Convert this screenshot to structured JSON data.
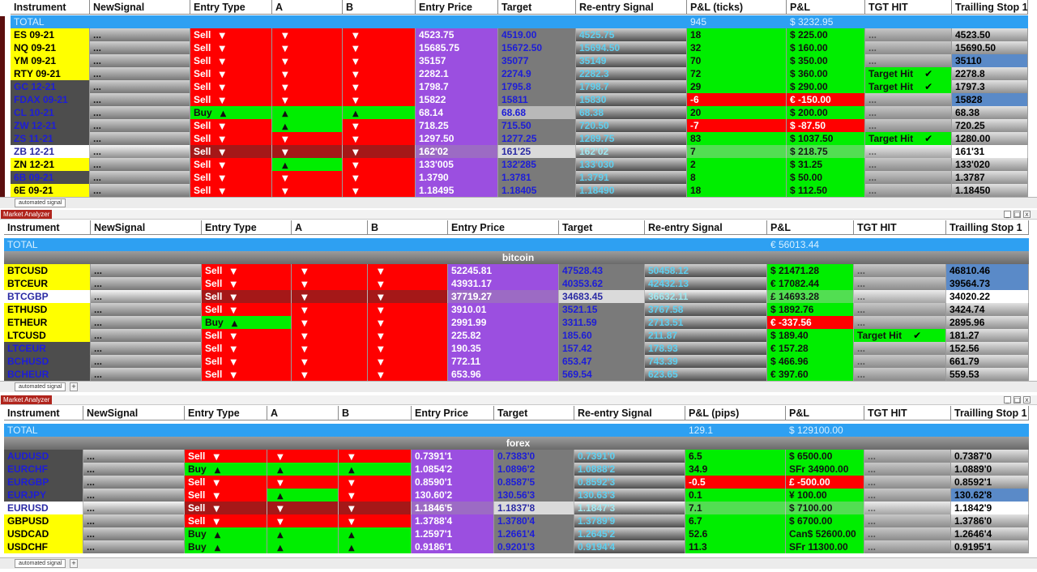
{
  "windows": [
    {
      "window_label": "",
      "tab_label": "automated signal",
      "columns": [
        "Instrument",
        "NewSignal",
        "Entry Type",
        "A",
        "B",
        "Entry Price",
        "Target",
        "Re-entry Signal",
        "P&L (ticks)",
        "P&L",
        "TGT HIT",
        "Trailling Stop 1"
      ],
      "total": {
        "label": "TOTAL",
        "ticks": "945",
        "pnl": "$ 3232.95"
      },
      "group": "",
      "rows": [
        {
          "inst": "ES 09-21",
          "sig": "...",
          "type": "Sell",
          "a": "▼",
          "b": "▼",
          "entry": "4523.75",
          "target": "4519.00",
          "reentry": "4525.75",
          "ticks": "18",
          "pnl": "$ 225.00",
          "tgt": "...",
          "trail": "4523.50",
          "ic": "yellow",
          "tc": "sell",
          "ac": "sell",
          "bc": "sell",
          "pc": "green",
          "hc": "empty",
          "sc": "trail",
          "tgc": "tgt"
        },
        {
          "inst": "NQ 09-21",
          "sig": "...",
          "type": "Sell",
          "a": "▼",
          "b": "▼",
          "entry": "15685.75",
          "target": "15672.50",
          "reentry": "15694.50",
          "ticks": "32",
          "pnl": "$ 160.00",
          "tgt": "...",
          "trail": "15690.50",
          "ic": "yellow",
          "tc": "sell",
          "ac": "sell",
          "bc": "sell",
          "pc": "green",
          "hc": "empty",
          "sc": "trail",
          "tgc": "tgt"
        },
        {
          "inst": "YM 09-21",
          "sig": "...",
          "type": "Sell",
          "a": "▼",
          "b": "▼",
          "entry": "35157",
          "target": "35077",
          "reentry": "35149",
          "ticks": "70",
          "pnl": "$ 350.00",
          "tgt": "...",
          "trail": "35110",
          "ic": "yellow",
          "tc": "sell",
          "ac": "sell",
          "bc": "sell",
          "pc": "green",
          "hc": "empty",
          "sc": "trailb",
          "tgc": "tgt"
        },
        {
          "inst": "RTY 09-21",
          "sig": "...",
          "type": "Sell",
          "a": "▼",
          "b": "▼",
          "entry": "2282.1",
          "target": "2274.9",
          "reentry": "2282.3",
          "ticks": "72",
          "pnl": "$ 360.00",
          "tgt": "Target Hit",
          "trail": "2278.8",
          "ic": "yellow",
          "tc": "sell",
          "ac": "sell",
          "bc": "sell",
          "pc": "green",
          "hc": "hit",
          "sc": "trail",
          "tgc": "tgt"
        },
        {
          "inst": "GC 12-21",
          "sig": "...",
          "type": "Sell",
          "a": "▼",
          "b": "▼",
          "entry": "1798.7",
          "target": "1795.8",
          "reentry": "1798.7",
          "ticks": "29",
          "pnl": "$ 290.00",
          "tgt": "Target Hit",
          "trail": "1797.3",
          "ic": "slate",
          "tc": "sell",
          "ac": "sell",
          "bc": "sell",
          "pc": "green",
          "hc": "hit",
          "sc": "trail",
          "tgc": "tgt"
        },
        {
          "inst": "FDAX 09-21",
          "sig": "...",
          "type": "Sell",
          "a": "▼",
          "b": "▼",
          "entry": "15822",
          "target": "15811",
          "reentry": "15830",
          "ticks": "-6",
          "pnl": "€ -150.00",
          "tgt": "...",
          "trail": "15828",
          "ic": "slate",
          "tc": "sell",
          "ac": "sell",
          "bc": "sell",
          "pc": "red",
          "hc": "empty",
          "sc": "trailb",
          "tgc": "tgt"
        },
        {
          "inst": "CL 10-21",
          "sig": "...",
          "type": "Buy",
          "a": "▲",
          "b": "▲",
          "entry": "68.14",
          "target": "68.68",
          "reentry": "68.38",
          "ticks": "20",
          "pnl": "$ 200.00",
          "tgt": "...",
          "trail": "68.38",
          "ic": "slate",
          "tc": "buy",
          "ac": "buy",
          "bc": "buy",
          "pc": "green",
          "hc": "empty",
          "sc": "trail",
          "tgc": "tgtl"
        },
        {
          "inst": "ZW 12-21",
          "sig": "...",
          "type": "Sell",
          "a": "▲",
          "b": "▼",
          "entry": "718.25",
          "target": "715.50",
          "reentry": "720.50",
          "ticks": "-7",
          "pnl": "$ -87.50",
          "tgt": "...",
          "trail": "720.25",
          "ic": "slate",
          "tc": "sell",
          "ac": "buy",
          "bc": "sell",
          "pc": "red",
          "hc": "empty",
          "sc": "trail",
          "tgc": "tgt"
        },
        {
          "inst": "ZS 11-21",
          "sig": "...",
          "type": "Sell",
          "a": "▼",
          "b": "▼",
          "entry": "1297.50",
          "target": "1277.25",
          "reentry": "1289.75",
          "ticks": "83",
          "pnl": "$ 1037.50",
          "tgt": "Target Hit",
          "trail": "1280.00",
          "ic": "slate",
          "tc": "sell",
          "ac": "sell",
          "bc": "sell",
          "pc": "green",
          "hc": "hit",
          "sc": "trail",
          "tgc": "tgt"
        },
        {
          "inst": "ZB 12-21",
          "sig": "...",
          "type": "Sell",
          "a": "▼",
          "b": "▼",
          "entry": "162'02",
          "target": "161'25",
          "reentry": "162'02",
          "ticks": "7",
          "pnl": "$ 218.75",
          "tgt": "...",
          "trail": "161'31",
          "ic": "white",
          "tc": "sell",
          "ac": "sell",
          "bc": "sell",
          "pc": "green",
          "hc": "empty",
          "sc": "trailw",
          "tgc": "tgtl",
          "hl": true
        },
        {
          "inst": "ZN 12-21",
          "sig": "...",
          "type": "Sell",
          "a": "▲",
          "b": "▼",
          "entry": "133'005",
          "target": "132'285",
          "reentry": "133'030",
          "ticks": "2",
          "pnl": "$ 31.25",
          "tgt": "...",
          "trail": "133'020",
          "ic": "ykeep",
          "tc": "sell",
          "ac": "buy",
          "bc": "sell",
          "pc": "green",
          "hc": "empty",
          "sc": "trail",
          "tgc": "tgt"
        },
        {
          "inst": "6B 09-21",
          "sig": "...",
          "type": "Sell",
          "a": "▼",
          "b": "▼",
          "entry": "1.3790",
          "target": "1.3781",
          "reentry": "1.3791",
          "ticks": "8",
          "pnl": "$ 50.00",
          "tgt": "...",
          "trail": "1.3787",
          "ic": "slate",
          "tc": "sell",
          "ac": "sell",
          "bc": "sell",
          "pc": "green",
          "hc": "empty",
          "sc": "trail",
          "tgc": "tgt"
        },
        {
          "inst": "6E 09-21",
          "sig": "...",
          "type": "Sell",
          "a": "▼",
          "b": "▼",
          "entry": "1.18495",
          "target": "1.18405",
          "reentry": "1.18490",
          "ticks": "18",
          "pnl": "$ 112.50",
          "tgt": "...",
          "trail": "1.18450",
          "ic": "yellow",
          "tc": "sell",
          "ac": "sell",
          "bc": "sell",
          "pc": "green",
          "hc": "empty",
          "sc": "trail",
          "tgc": "tgt"
        }
      ]
    },
    {
      "window_label": "Market Analyzer",
      "tab_label": "automated signal",
      "columns": [
        "Instrument",
        "NewSignal",
        "Entry Type",
        "A",
        "B",
        "Entry Price",
        "Target",
        "Re-entry Signal",
        "P&L",
        "TGT HIT",
        "Trailling Stop 1"
      ],
      "total": {
        "label": "TOTAL",
        "ticks": "",
        "pnl": "€ 56013.44"
      },
      "group": "bitcoin",
      "rows": [
        {
          "inst": "BTCUSD",
          "sig": "...",
          "type": "Sell",
          "a": "▼",
          "b": "▼",
          "entry": "52245.81",
          "target": "47528.43",
          "reentry": "50458.12",
          "pnl": "$ 21471.28",
          "tgt": "...",
          "trail": "46810.46",
          "ic": "yellow",
          "tc": "sell",
          "ac": "sell",
          "bc": "sell",
          "pc": "green",
          "hc": "empty",
          "sc": "trailb",
          "tgc": "tgt"
        },
        {
          "inst": "BTCEUR",
          "sig": "...",
          "type": "Sell",
          "a": "▼",
          "b": "▼",
          "entry": "43931.17",
          "target": "40353.62",
          "reentry": "42432.13",
          "pnl": "€ 17082.44",
          "tgt": "...",
          "trail": "39564.73",
          "ic": "yellow",
          "tc": "sell",
          "ac": "sell",
          "bc": "sell",
          "pc": "green",
          "hc": "empty",
          "sc": "trailb",
          "tgc": "tgt"
        },
        {
          "inst": "BTCGBP",
          "sig": "...",
          "type": "Sell",
          "a": "▼",
          "b": "▼",
          "entry": "37719.27",
          "target": "34683.45",
          "reentry": "36632.11",
          "pnl": "£ 14693.28",
          "tgt": "...",
          "trail": "34020.22",
          "ic": "white",
          "tc": "sell",
          "ac": "sell",
          "bc": "sell",
          "pc": "green",
          "hc": "empty",
          "sc": "trailw",
          "tgc": "tgtl",
          "hl": true
        },
        {
          "inst": "ETHUSD",
          "sig": "...",
          "type": "Sell",
          "a": "▼",
          "b": "▼",
          "entry": "3910.01",
          "target": "3521.15",
          "reentry": "3767.58",
          "pnl": "$ 1892.76",
          "tgt": "...",
          "trail": "3424.74",
          "ic": "yellow",
          "tc": "sell",
          "ac": "sell",
          "bc": "sell",
          "pc": "green",
          "hc": "empty",
          "sc": "trail",
          "tgc": "tgt"
        },
        {
          "inst": "ETHEUR",
          "sig": "...",
          "type": "Buy",
          "a": "▼",
          "b": "▼",
          "entry": "2991.99",
          "target": "3311.59",
          "reentry": "2713.51",
          "pnl": "€ -337.56",
          "tgt": "...",
          "trail": "2895.96",
          "ic": "yellow",
          "tc": "buy",
          "ac": "sell",
          "bc": "sell",
          "pc": "red",
          "hc": "empty",
          "sc": "trail",
          "tgc": "tgt"
        },
        {
          "inst": "LTCUSD",
          "sig": "...",
          "type": "Sell",
          "a": "▼",
          "b": "▼",
          "entry": "225.82",
          "target": "185.60",
          "reentry": "211.87",
          "pnl": "$ 189.40",
          "tgt": "Target Hit",
          "trail": "181.27",
          "ic": "yellow",
          "tc": "sell",
          "ac": "sell",
          "bc": "sell",
          "pc": "green",
          "hc": "hit",
          "sc": "trail",
          "tgc": "tgt"
        },
        {
          "inst": "LTCEUR",
          "sig": "...",
          "type": "Sell",
          "a": "▼",
          "b": "▼",
          "entry": "190.35",
          "target": "157.42",
          "reentry": "178.93",
          "pnl": "€ 157.28",
          "tgt": "...",
          "trail": "152.56",
          "ic": "slate",
          "tc": "sell",
          "ac": "sell",
          "bc": "sell",
          "pc": "green",
          "hc": "empty",
          "sc": "trail",
          "tgc": "tgt"
        },
        {
          "inst": "BCHUSD",
          "sig": "...",
          "type": "Sell",
          "a": "▼",
          "b": "▼",
          "entry": "772.11",
          "target": "653.47",
          "reentry": "743.39",
          "pnl": "$ 466.96",
          "tgt": "...",
          "trail": "661.79",
          "ic": "slate",
          "tc": "sell",
          "ac": "sell",
          "bc": "sell",
          "pc": "green",
          "hc": "empty",
          "sc": "trail",
          "tgc": "tgt"
        },
        {
          "inst": "BCHEUR",
          "sig": "...",
          "type": "Sell",
          "a": "▼",
          "b": "▼",
          "entry": "653.96",
          "target": "569.54",
          "reentry": "623.65",
          "pnl": "€ 397.60",
          "tgt": "...",
          "trail": "559.53",
          "ic": "slate",
          "tc": "sell",
          "ac": "sell",
          "bc": "sell",
          "pc": "green",
          "hc": "empty",
          "sc": "trail",
          "tgc": "tgt"
        }
      ]
    },
    {
      "window_label": "Market Analyzer",
      "tab_label": "automated signal",
      "columns": [
        "Instrument",
        "NewSignal",
        "Entry Type",
        "A",
        "B",
        "Entry Price",
        "Target",
        "Re-entry Signal",
        "P&L (pips)",
        "P&L",
        "TGT HIT",
        "Trailling Stop 1"
      ],
      "total": {
        "label": "TOTAL",
        "ticks": "129.1",
        "pnl": "$ 129100.00"
      },
      "group": "forex",
      "rows": [
        {
          "inst": "AUDUSD",
          "sig": "...",
          "type": "Sell",
          "a": "▼",
          "b": "▼",
          "entry": "0.7391'1",
          "target": "0.7383'0",
          "reentry": "0.7391'0",
          "ticks": "6.5",
          "pnl": "$ 6500.00",
          "tgt": "...",
          "trail": "0.7387'0",
          "ic": "slate",
          "tc": "sell",
          "ac": "sell",
          "bc": "sell",
          "pc": "green",
          "hc": "empty",
          "sc": "trail",
          "tgc": "tgt"
        },
        {
          "inst": "EURCHF",
          "sig": "...",
          "type": "Buy",
          "a": "▲",
          "b": "▲",
          "entry": "1.0854'2",
          "target": "1.0896'2",
          "reentry": "1.0888'2",
          "ticks": "34.9",
          "pnl": "SFr 34900.00",
          "tgt": "...",
          "trail": "1.0889'0",
          "ic": "slate",
          "tc": "buy",
          "ac": "buy",
          "bc": "buy",
          "pc": "green",
          "hc": "empty",
          "sc": "trail",
          "tgc": "tgt"
        },
        {
          "inst": "EURGBP",
          "sig": "...",
          "type": "Sell",
          "a": "▼",
          "b": "▼",
          "entry": "0.8590'1",
          "target": "0.8587'5",
          "reentry": "0.8592'3",
          "ticks": "-0.5",
          "pnl": "£ -500.00",
          "tgt": "...",
          "trail": "0.8592'1",
          "ic": "slate",
          "tc": "sell",
          "ac": "sell",
          "bc": "sell",
          "pc": "red",
          "hc": "empty",
          "sc": "trail",
          "tgc": "tgt"
        },
        {
          "inst": "EURJPY",
          "sig": "...",
          "type": "Sell",
          "a": "▲",
          "b": "▼",
          "entry": "130.60'2",
          "target": "130.56'3",
          "reentry": "130.63'3",
          "ticks": "0.1",
          "pnl": "¥ 100.00",
          "tgt": "...",
          "trail": "130.62'8",
          "ic": "slate",
          "tc": "sell",
          "ac": "buy",
          "bc": "sell",
          "pc": "green",
          "hc": "empty",
          "sc": "trailb",
          "tgc": "tgt"
        },
        {
          "inst": "EURUSD",
          "sig": "...",
          "type": "Sell",
          "a": "▼",
          "b": "▼",
          "entry": "1.1846'5",
          "target": "1.1837'8",
          "reentry": "1.1847'3",
          "ticks": "7.1",
          "pnl": "$ 7100.00",
          "tgt": "...",
          "trail": "1.1842'9",
          "ic": "white",
          "tc": "sell",
          "ac": "sell",
          "bc": "sell",
          "pc": "green",
          "hc": "empty",
          "sc": "trailw",
          "tgc": "tgtl",
          "hl": true
        },
        {
          "inst": "GBPUSD",
          "sig": "...",
          "type": "Sell",
          "a": "▼",
          "b": "▼",
          "entry": "1.3788'4",
          "target": "1.3780'4",
          "reentry": "1.3789'9",
          "ticks": "6.7",
          "pnl": "$ 6700.00",
          "tgt": "...",
          "trail": "1.3786'0",
          "ic": "yellow",
          "tc": "sell",
          "ac": "sell",
          "bc": "sell",
          "pc": "green",
          "hc": "empty",
          "sc": "trail",
          "tgc": "tgt"
        },
        {
          "inst": "USDCAD",
          "sig": "...",
          "type": "Buy",
          "a": "▲",
          "b": "▲",
          "entry": "1.2597'1",
          "target": "1.2661'4",
          "reentry": "1.2645'2",
          "ticks": "52.6",
          "pnl": "Can$ 52600.00",
          "tgt": "...",
          "trail": "1.2646'4",
          "ic": "yellow",
          "tc": "buy",
          "ac": "buy",
          "bc": "buy",
          "pc": "green",
          "hc": "empty",
          "sc": "trail",
          "tgc": "tgt"
        },
        {
          "inst": "USDCHF",
          "sig": "...",
          "type": "Buy",
          "a": "▲",
          "b": "▲",
          "entry": "0.9186'1",
          "target": "0.9201'3",
          "reentry": "0.9194'4",
          "ticks": "11.3",
          "pnl": "SFr 11300.00",
          "tgt": "...",
          "trail": "0.9195'1",
          "ic": "yellow",
          "tc": "buy",
          "ac": "buy",
          "bc": "buy",
          "pc": "green",
          "hc": "empty",
          "sc": "trail",
          "tgc": "tgt"
        }
      ]
    }
  ],
  "icons": {
    "arrow_up": "▲",
    "arrow_down": "▼",
    "check": "✔",
    "minimize": "_",
    "maximize": "□",
    "close": "x",
    "add_tab": "+"
  },
  "colors": {
    "sell": "#ff0000",
    "buy": "#00ee00",
    "entry": "#9b4fe0",
    "total": "#2ea0f2",
    "instrument_highlight": "#ffff00"
  }
}
